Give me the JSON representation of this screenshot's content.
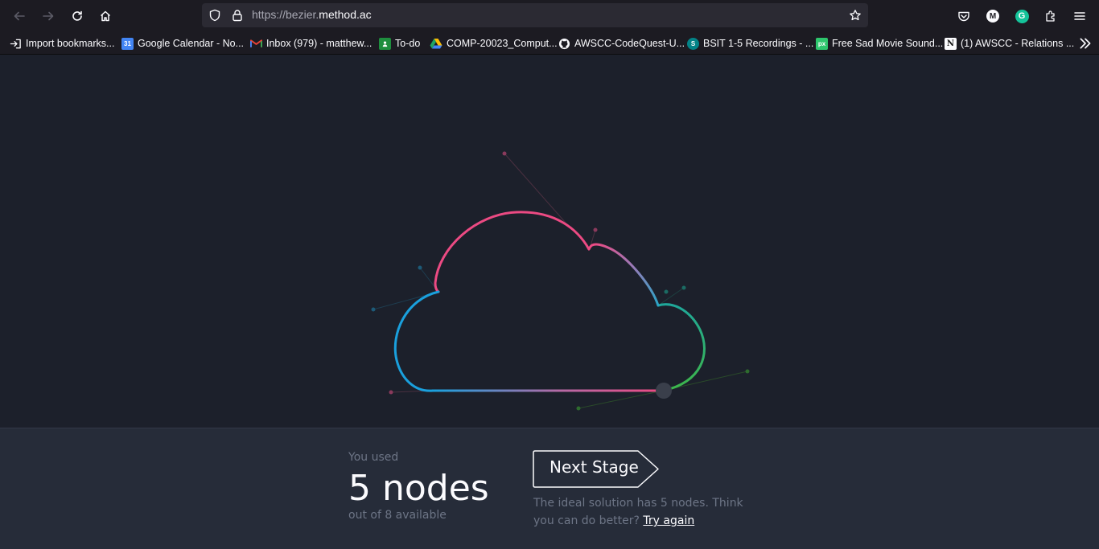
{
  "browser": {
    "url_prefix": "https://bezier.",
    "url_domain": "method.ac",
    "bookmarks": [
      {
        "label": "Import bookmarks...",
        "icon": "import-icon",
        "color": "#fbfbfe"
      },
      {
        "label": "Google Calendar - No...",
        "icon": "google-calendar-icon",
        "color": "#4285f4"
      },
      {
        "label": "Inbox (979) - matthew...",
        "icon": "gmail-icon",
        "color": "#ea4335"
      },
      {
        "label": "To-do",
        "icon": "google-classroom-icon",
        "color": "#1e8e3e"
      },
      {
        "label": "COMP-20023_Comput...",
        "icon": "google-drive-icon",
        "color": "#fbbc04"
      },
      {
        "label": "AWSCC-CodeQuest-U...",
        "icon": "github-icon",
        "color": "#fbfbfe"
      },
      {
        "label": "BSIT 1-5 Recordings - ...",
        "icon": "sharepoint-icon",
        "color": "#038387"
      },
      {
        "label": "Free Sad Movie Sound...",
        "icon": "pixabay-icon",
        "color": "#2ec66d"
      },
      {
        "label": "(1) AWSCC - Relations ...",
        "icon": "notion-icon",
        "color": "#fbfbfe"
      }
    ]
  },
  "stats": {
    "used_label": "You used",
    "nodes": "5 nodes",
    "available": "out of 8 available"
  },
  "actions": {
    "next_stage": "Next Stage",
    "feedback": "The ideal solution has 5 nodes. Think you can do better?",
    "try_again": "Try again"
  },
  "colors": {
    "pink": "#ec4a83",
    "blue": "#1aa0dd",
    "green": "#3db64a",
    "teal": "#1fa89a",
    "panel": "#262c39",
    "canvas": "#1c202b"
  }
}
